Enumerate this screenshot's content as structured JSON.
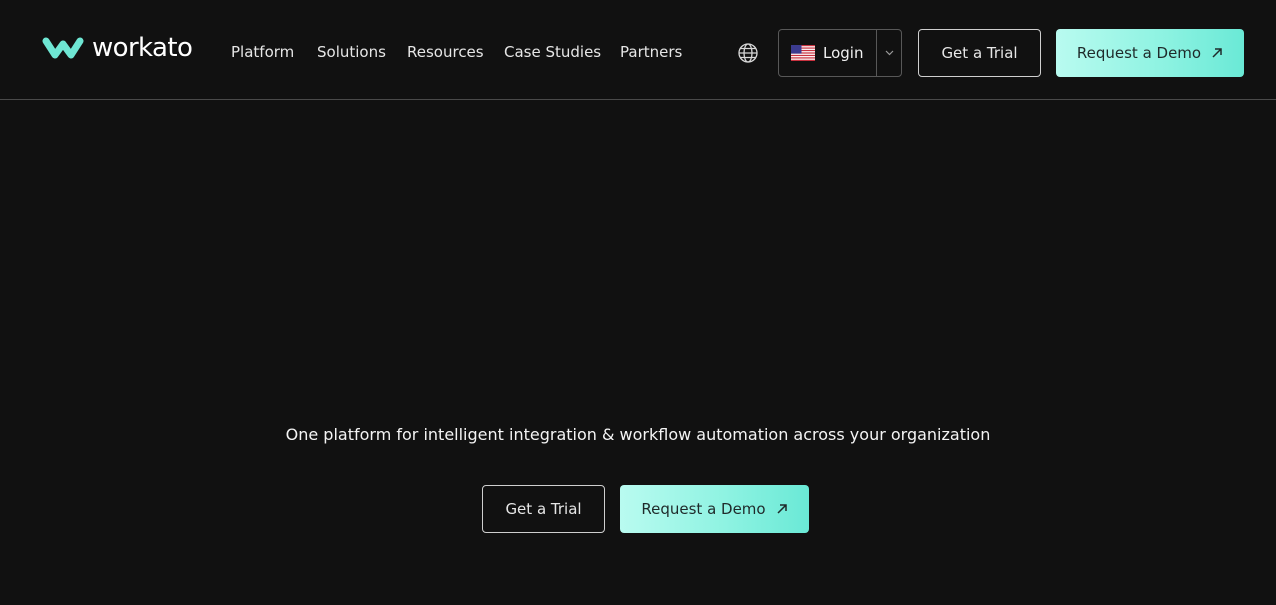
{
  "brand": {
    "name": "workato",
    "accent": "#6ee6d3"
  },
  "nav": {
    "items": [
      {
        "id": "platform",
        "label": "Platform"
      },
      {
        "id": "solutions",
        "label": "Solutions"
      },
      {
        "id": "resources",
        "label": "Resources"
      },
      {
        "id": "case-studies",
        "label": "Case Studies"
      },
      {
        "id": "partners",
        "label": "Partners"
      }
    ]
  },
  "header": {
    "language_icon": "globe-icon",
    "login": {
      "label": "Login",
      "flag": "us-flag-icon",
      "caret": "chevron-down-icon"
    },
    "trial_label": "Get a Trial",
    "demo_label": "Request a Demo"
  },
  "hero": {
    "tagline": "One platform for intelligent integration & workflow automation across your organization",
    "trial_label": "Get a Trial",
    "demo_label": "Request a Demo"
  },
  "colors": {
    "background": "#111111",
    "demo_gradient_start": "#b9fbf0",
    "demo_gradient_end": "#6ae9d6"
  }
}
